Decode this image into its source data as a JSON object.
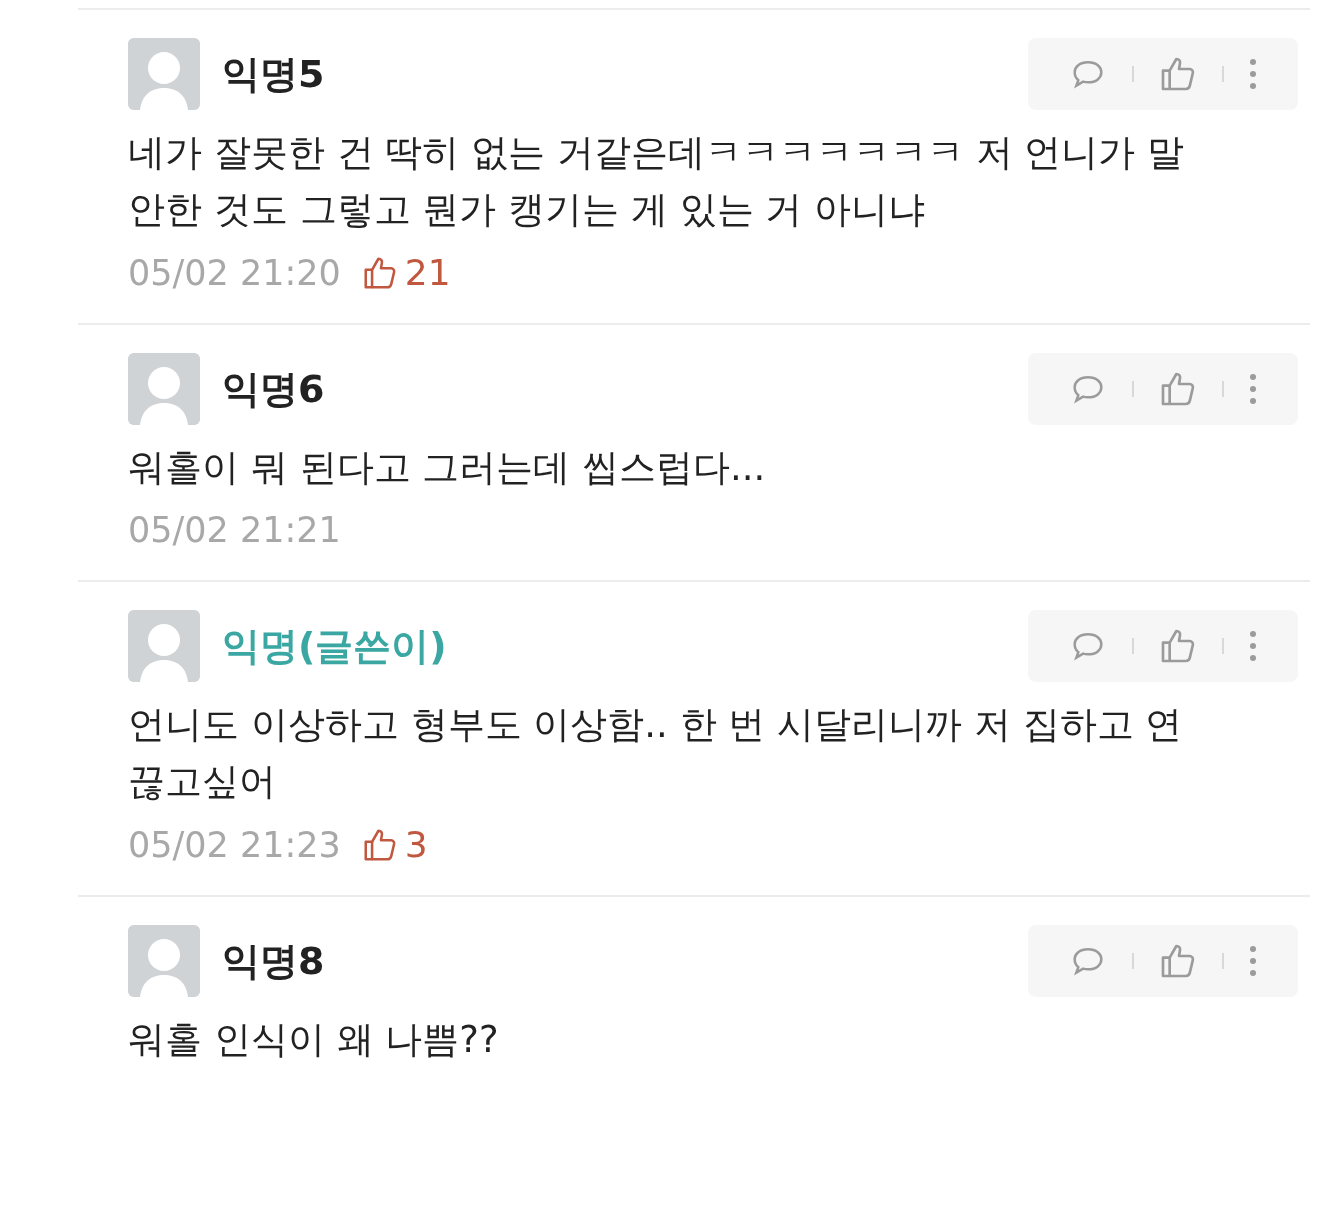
{
  "comments": [
    {
      "name": "익명5",
      "is_writer": false,
      "text": "네가 잘못한 건 딱히 없는 거같은데ㅋㅋㅋㅋㅋㅋㅋ 저 언니가 말 안한 것도 그렇고 뭔가 캥기는 게 있는 거 아니냐",
      "time": "05/02 21:20",
      "likes": "21"
    },
    {
      "name": "익명6",
      "is_writer": false,
      "text": "워홀이 뭐 된다고 그러는데 씹스럽다...",
      "time": "05/02 21:21"
    },
    {
      "name": "익명(글쓴이)",
      "is_writer": true,
      "text": "언니도 이상하고 형부도 이상함.. 한 번 시달리니까 저 집하고 연 끊고싶어",
      "time": "05/02 21:23",
      "likes": "3"
    },
    {
      "name": "익명8",
      "is_writer": false,
      "text": "워홀 인식이 왜 나쁨??"
    }
  ]
}
